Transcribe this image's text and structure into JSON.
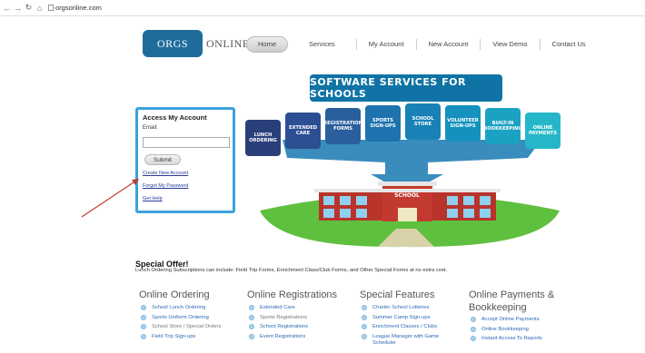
{
  "browser": {
    "back_icon": "arrow-left-icon",
    "forward_icon": "arrow-right-icon",
    "reload_icon": "reload-icon",
    "home_icon": "home-icon",
    "url": "orgsonline.com"
  },
  "logo": {
    "first": "ORGS",
    "second": "ONLINE"
  },
  "nav": {
    "items": [
      "Home",
      "Services",
      "My Account",
      "New Account",
      "View Demo",
      "Contact Us"
    ]
  },
  "login": {
    "title": "Access My Account",
    "email_label": "Email:",
    "email_value": "",
    "submit": "Submit",
    "links": [
      "Create New Account",
      "Forgot My Password",
      "Get Help"
    ]
  },
  "hero": {
    "banner": "SOFTWARE SERVICES FOR SCHOOLS",
    "school_sign": "SCHOOL",
    "tiles": [
      {
        "label": "LUNCH ORDERING",
        "color": "#2a3f7a"
      },
      {
        "label": "EXTENDED CARE",
        "color": "#2c4e92"
      },
      {
        "label": "REGISTRATION FORMS",
        "color": "#2a5f9e"
      },
      {
        "label": "SPORTS SIGN-UPS",
        "color": "#1e73ae"
      },
      {
        "label": "SCHOOL STORE",
        "color": "#1882b6"
      },
      {
        "label": "VOLUNTEER SIGN-UPS",
        "color": "#1492bd"
      },
      {
        "label": "BUILT-IN BOOKKEEPING",
        "color": "#1aa2c3"
      },
      {
        "label": "ONLINE PAYMENTS",
        "color": "#25b7c9"
      }
    ]
  },
  "offer": {
    "title": "Special Offer!",
    "text": "Lunch Ordering Subscriptions can include: Field Trip Forms, Enrichment Class/Club Forms, and Other Special Forms at no extra cost."
  },
  "features": [
    {
      "heading": "Online Ordering",
      "items": [
        "School Lunch Ordering",
        "Sports Uniform Ordering",
        "School Store / Special Orders",
        "Field Trip Sign-ups"
      ]
    },
    {
      "heading": "Online Registrations",
      "items": [
        "Extended Care",
        "Sports Registrations",
        "School Registrations",
        "Event Registrations"
      ]
    },
    {
      "heading": "Special Features",
      "items": [
        "Charter School Lotteries",
        "Summer Camp Sign-ups",
        "Enrichment Classes / Clubs",
        "League Manager with Game Scheduler"
      ]
    },
    {
      "heading_line1": "Online Payments &",
      "heading_line2": "Bookkeeping",
      "items": [
        "Accept Online Payments",
        "Online Bookkeeping",
        "Instant Access To Reports"
      ]
    }
  ],
  "colors": {
    "brand": "#1f6c9c",
    "login_border": "#3aa2dc",
    "annotation_arrow": "#c0392b",
    "link": "#2a3c9a",
    "feature_link": "#2a6ab5"
  }
}
